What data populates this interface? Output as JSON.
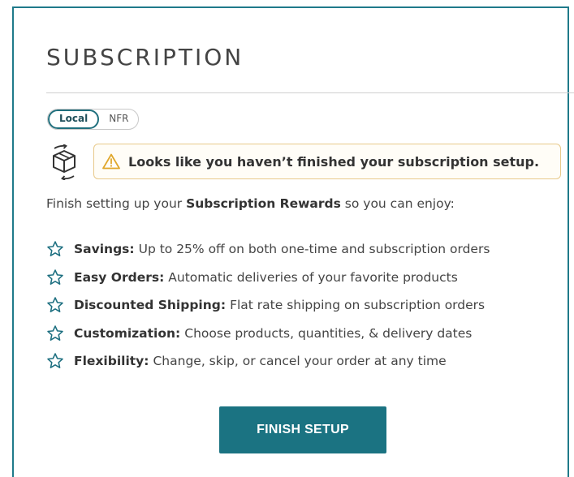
{
  "title": "SUBSCRIPTION",
  "toggle": {
    "options": [
      "Local",
      "NFR"
    ],
    "selected": "Local"
  },
  "warning": {
    "icon": "warning-triangle-icon",
    "text": "Looks like you haven’t finished your subscription setup."
  },
  "intro": {
    "prefix": "Finish setting up your ",
    "bold": "Subscription Rewards",
    "suffix": " so you can enjoy:"
  },
  "benefits": [
    {
      "icon": "star-outline-icon",
      "title": "Savings:",
      "text": "Up to 25% off on both one-time and subscription orders"
    },
    {
      "icon": "star-outline-icon",
      "title": "Easy Orders:",
      "text": "Automatic deliveries of your favorite products"
    },
    {
      "icon": "star-outline-icon",
      "title": "Discounted Shipping:",
      "text": "Flat rate shipping on subscription orders"
    },
    {
      "icon": "star-outline-icon",
      "title": "Customization:",
      "text": "Choose products, quantities, & delivery dates"
    },
    {
      "icon": "star-outline-icon",
      "title": "Flexibility:",
      "text": "Change, skip, or cancel your order at any time"
    }
  ],
  "cta": {
    "label": "FINISH SETUP"
  },
  "colors": {
    "accent": "#1b7382",
    "warning_border": "#e8c98a",
    "card_border": "#1f7a8a"
  }
}
